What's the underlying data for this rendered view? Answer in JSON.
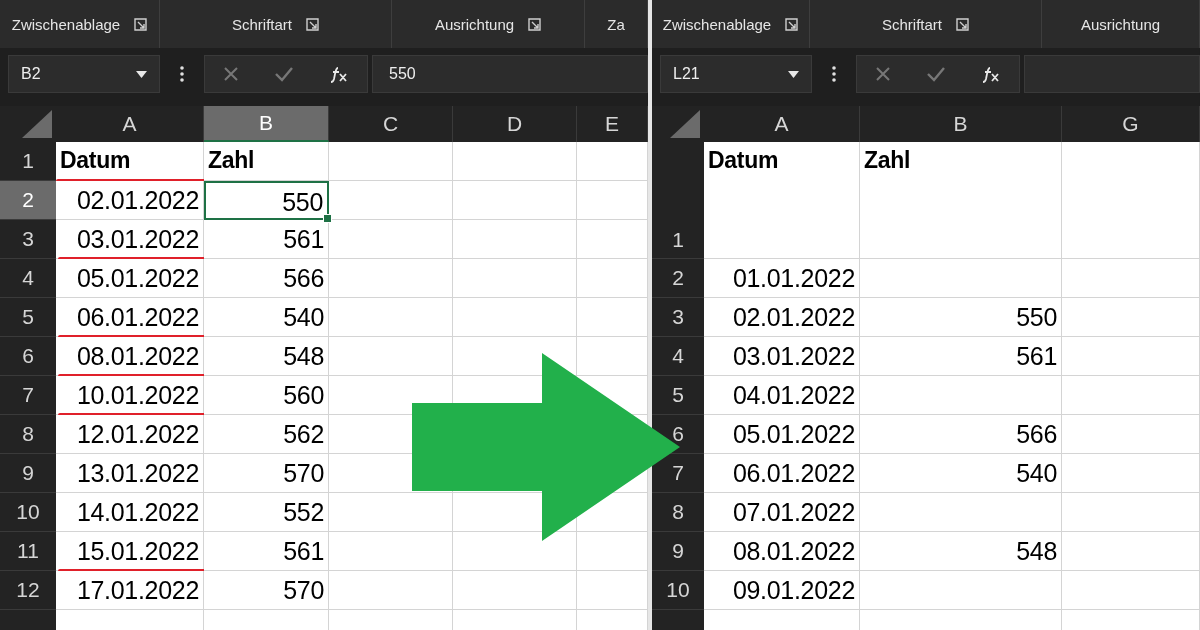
{
  "panes": [
    {
      "ribbon_groups": [
        {
          "label": "Zwischenablage",
          "launcher": true
        },
        {
          "label": "Schriftart",
          "launcher": true
        },
        {
          "label": "Ausrichtung",
          "launcher": true
        },
        {
          "label": "Za",
          "launcher": false
        }
      ],
      "name_box": "B2",
      "formula": "550",
      "columns": [
        {
          "label": "A",
          "selected": false
        },
        {
          "label": "B",
          "selected": true
        },
        {
          "label": "C",
          "selected": false
        },
        {
          "label": "D",
          "selected": false
        },
        {
          "label": "E",
          "selected": false
        }
      ],
      "rows": [
        {
          "number": "1",
          "kind": "header",
          "selected": false,
          "underlined": true,
          "cells": [
            "Datum",
            "Zahl"
          ]
        },
        {
          "number": "2",
          "kind": "data",
          "selected": true,
          "underlined": false,
          "cells": [
            "02.01.2022",
            "550"
          ]
        },
        {
          "number": "3",
          "kind": "data",
          "selected": false,
          "underlined": true,
          "cells": [
            "03.01.2022",
            "561"
          ]
        },
        {
          "number": "4",
          "kind": "data",
          "selected": false,
          "underlined": false,
          "cells": [
            "05.01.2022",
            "566"
          ]
        },
        {
          "number": "5",
          "kind": "data",
          "selected": false,
          "underlined": true,
          "cells": [
            "06.01.2022",
            "540"
          ]
        },
        {
          "number": "6",
          "kind": "data",
          "selected": false,
          "underlined": true,
          "cells": [
            "08.01.2022",
            "548"
          ]
        },
        {
          "number": "7",
          "kind": "data",
          "selected": false,
          "underlined": true,
          "cells": [
            "10.01.2022",
            "560"
          ]
        },
        {
          "number": "8",
          "kind": "data",
          "selected": false,
          "underlined": false,
          "cells": [
            "12.01.2022",
            "562"
          ]
        },
        {
          "number": "9",
          "kind": "data",
          "selected": false,
          "underlined": false,
          "cells": [
            "13.01.2022",
            "570"
          ]
        },
        {
          "number": "10",
          "kind": "data",
          "selected": false,
          "underlined": false,
          "cells": [
            "14.01.2022",
            "552"
          ]
        },
        {
          "number": "11",
          "kind": "data",
          "selected": false,
          "underlined": true,
          "cells": [
            "15.01.2022",
            "561"
          ]
        },
        {
          "number": "12",
          "kind": "data",
          "selected": false,
          "underlined": false,
          "cells": [
            "17.01.2022",
            "570"
          ]
        }
      ]
    },
    {
      "ribbon_groups": [
        {
          "label": "Zwischenablage",
          "launcher": true
        },
        {
          "label": "Schriftart",
          "launcher": true
        },
        {
          "label": "Ausrichtung",
          "launcher": false
        }
      ],
      "name_box": "L21",
      "columns": [
        {
          "label": "A",
          "selected": false
        },
        {
          "label": "B",
          "selected": false
        },
        {
          "label": "G",
          "selected": false
        }
      ],
      "rows": [
        {
          "number": "1",
          "kind": "tall-header",
          "selected": false,
          "cells": [
            "Datum",
            "Zahl"
          ]
        },
        {
          "number": "2",
          "kind": "data",
          "selected": false,
          "cells": [
            "01.01.2022"
          ]
        },
        {
          "number": "3",
          "kind": "data",
          "selected": false,
          "cells": [
            "02.01.2022",
            "550"
          ]
        },
        {
          "number": "4",
          "kind": "data",
          "selected": false,
          "cells": [
            "03.01.2022",
            "561"
          ]
        },
        {
          "number": "5",
          "kind": "data",
          "selected": false,
          "cells": [
            "04.01.2022"
          ]
        },
        {
          "number": "6",
          "kind": "data",
          "selected": false,
          "cells": [
            "05.01.2022",
            "566"
          ]
        },
        {
          "number": "7",
          "kind": "data",
          "selected": false,
          "cells": [
            "06.01.2022",
            "540"
          ]
        },
        {
          "number": "8",
          "kind": "data",
          "selected": false,
          "cells": [
            "07.01.2022"
          ]
        },
        {
          "number": "9",
          "kind": "data",
          "selected": false,
          "cells": [
            "08.01.2022",
            "548"
          ]
        },
        {
          "number": "10",
          "kind": "data",
          "selected": false,
          "cells": [
            "09.01.2022"
          ]
        }
      ]
    }
  ]
}
